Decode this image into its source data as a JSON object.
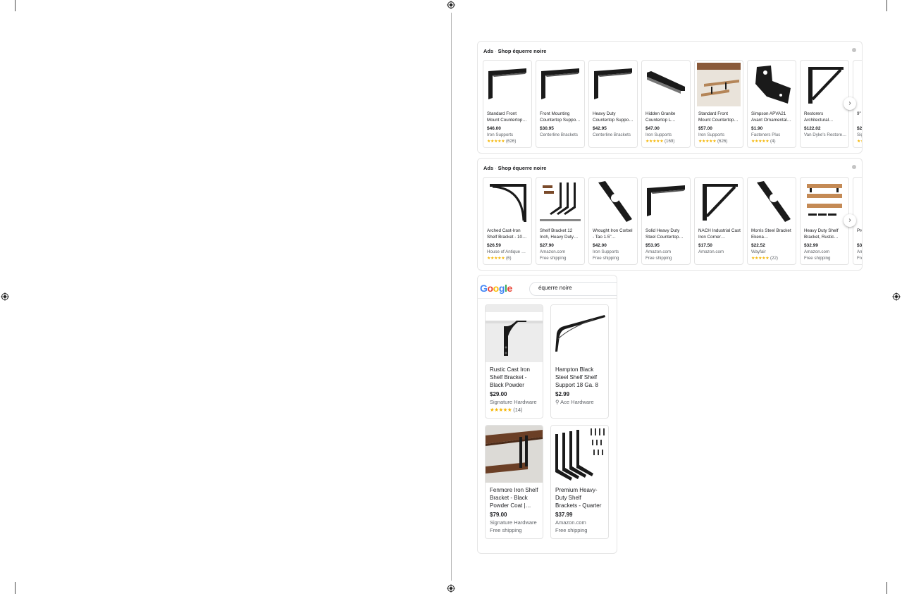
{
  "ads_panel_1": {
    "ads_label": "Ads",
    "separator": "·",
    "title": "Shop équerre noire",
    "products": [
      {
        "title": "Standard Front Mount Countertop…",
        "price": "$46.00",
        "seller": "Iron Supports",
        "stars": "★★★★★",
        "reviews": "(626)",
        "icon": "l-bracket-image"
      },
      {
        "title": "Front Mounting Countertop Suppo…",
        "price": "$30.95",
        "seller": "Centerline Brackets",
        "stars": "",
        "reviews": "",
        "icon": "l-bracket-image"
      },
      {
        "title": "Heavy Duty Countertop Suppo…",
        "price": "$42.95",
        "seller": "Centerline Brackets",
        "stars": "",
        "reviews": "",
        "icon": "l-bracket-image"
      },
      {
        "title": "Hidden Granite Countertop L…",
        "price": "$47.00",
        "seller": "Iron Supports",
        "stars": "★★★★★",
        "reviews": "(169)",
        "icon": "flat-bracket-image"
      },
      {
        "title": "Standard Front Mount Countertop…",
        "price": "$57.00",
        "seller": "Iron Supports",
        "stars": "★★★★★",
        "reviews": "(626)",
        "icon": "shelves-photo-image"
      },
      {
        "title": "Simpson APVA21 Avant Ornamental…",
        "price": "$1.90",
        "seller": "Fasteners Plus",
        "stars": "★★★★★",
        "reviews": "(4)",
        "icon": "angle-plate-image"
      },
      {
        "title": "Restorers Architectural…",
        "price": "$122.02",
        "seller": "Van Dyke's Restore…",
        "stars": "",
        "reviews": "",
        "icon": "triangle-bracket-image"
      },
      {
        "title": "9\" Hampton Iron S…",
        "price": "$29.0",
        "seller": "Signat…",
        "stars": "★★",
        "reviews": "",
        "icon": "partial-bracket-image"
      }
    ]
  },
  "ads_panel_2": {
    "ads_label": "Ads",
    "separator": "·",
    "title": "Shop équerre noire",
    "products": [
      {
        "title": "Arched Cast-Iron Shelf Bracket - 10…",
        "price": "$26.59",
        "seller": "House of Antique …",
        "stars": "★★★★★",
        "reviews": "(6)",
        "icon": "arched-bracket-image"
      },
      {
        "title": "Shelf Bracket 12 Inch, Heavy Duty…",
        "price": "$27.90",
        "seller": "Amazon.com",
        "stars": "",
        "reviews": "",
        "extra": "Free shipping",
        "icon": "bracket-set-image"
      },
      {
        "title": "Wrought Iron Corbel - Tao 1.5\"…",
        "price": "$42.00",
        "seller": "Iron Supports",
        "stars": "",
        "reviews": "",
        "extra": "Free shipping",
        "icon": "corbel-image"
      },
      {
        "title": "Solid Heavy Duty Steel Countertop…",
        "price": "$53.95",
        "seller": "Amazon.com",
        "stars": "",
        "reviews": "",
        "extra": "Free shipping",
        "icon": "l-bracket-image"
      },
      {
        "title": "NACH Industrial Cast Iron Corner…",
        "price": "$17.50",
        "seller": "Amazon.com",
        "stars": "",
        "reviews": "",
        "icon": "triangle-bracket-image"
      },
      {
        "title": "Morris Steel Bracket Ekena…",
        "price": "$22.52",
        "seller": "Wayfair",
        "stars": "★★★★★",
        "reviews": "(22)",
        "icon": "corbel-image"
      },
      {
        "title": "Heavy Duty Shelf Bracket, Rustic…",
        "price": "$32.99",
        "seller": "Amazon.com",
        "stars": "",
        "reviews": "",
        "extra": "Free shipping",
        "icon": "wood-shelves-image"
      },
      {
        "title": "Premi… Duty S…",
        "price": "$39.9",
        "seller": "Amaz…",
        "stars": "",
        "reviews": "",
        "extra": "Free s…",
        "icon": "partial-bracket-image"
      }
    ]
  },
  "google_panel": {
    "logo": "Google",
    "search_value": "équerre noire",
    "products": [
      {
        "title": "Rustic Cast Iron Shelf Bracket - Black Powder Coa…",
        "price": "$29.00",
        "seller": "Signature Hardware",
        "stars": "★★★★★",
        "reviews": "(14)",
        "extra": ""
      },
      {
        "title": "Hampton Black Steel Shelf Shelf Support 18 Ga. 8 i…",
        "price": "$2.99",
        "seller": "Ace Hardware",
        "stars": "",
        "reviews": "",
        "extra": ""
      },
      {
        "title": "Fenmore Iron Shelf Bracket - Black Powder Coat |…",
        "price": "$79.00",
        "seller": "Signature Hardware",
        "stars": "",
        "reviews": "",
        "extra": "Free shipping"
      },
      {
        "title": "Premium Heavy-Duty Shelf Brackets - Quarter Inch (1/4…",
        "price": "$37.99",
        "seller": "Amazon.com",
        "stars": "",
        "reviews": "",
        "extra": "Free shipping"
      }
    ]
  },
  "colors": {
    "star": "#f4b400",
    "bracket": "#1a1a1a",
    "wood": "#8a5a3a"
  }
}
